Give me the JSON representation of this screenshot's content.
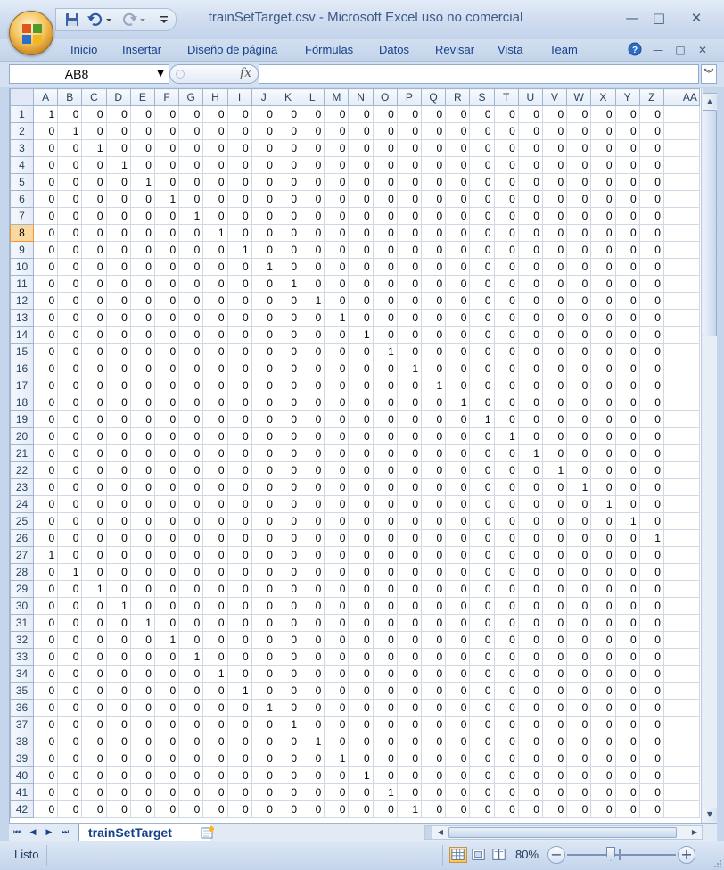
{
  "window": {
    "title": "trainSetTarget.csv - Microsoft Excel uso no comercial",
    "minimize": "—",
    "maximize": "□",
    "close": "✕"
  },
  "ribbon": {
    "tabs": [
      "Inicio",
      "Insertar",
      "Diseño de página",
      "Fórmulas",
      "Datos",
      "Revisar",
      "Vista",
      "Team"
    ]
  },
  "formula_bar": {
    "name_box": "AB8",
    "fx_label": "fx",
    "formula": ""
  },
  "grid": {
    "columns": [
      "A",
      "B",
      "C",
      "D",
      "E",
      "F",
      "G",
      "H",
      "I",
      "J",
      "K",
      "L",
      "M",
      "N",
      "O",
      "P",
      "Q",
      "R",
      "S",
      "T",
      "U",
      "V",
      "W",
      "X",
      "Y",
      "Z",
      "AA"
    ],
    "selected_row": 8,
    "rows": [
      {
        "n": 1,
        "hot": 0
      },
      {
        "n": 2,
        "hot": 1
      },
      {
        "n": 3,
        "hot": 2
      },
      {
        "n": 4,
        "hot": 3
      },
      {
        "n": 5,
        "hot": 4
      },
      {
        "n": 6,
        "hot": 5
      },
      {
        "n": 7,
        "hot": 6
      },
      {
        "n": 8,
        "hot": 7
      },
      {
        "n": 9,
        "hot": 8
      },
      {
        "n": 10,
        "hot": 9
      },
      {
        "n": 11,
        "hot": 10
      },
      {
        "n": 12,
        "hot": 11
      },
      {
        "n": 13,
        "hot": 12
      },
      {
        "n": 14,
        "hot": 13
      },
      {
        "n": 15,
        "hot": 14
      },
      {
        "n": 16,
        "hot": 15
      },
      {
        "n": 17,
        "hot": 16
      },
      {
        "n": 18,
        "hot": 17
      },
      {
        "n": 19,
        "hot": 18
      },
      {
        "n": 20,
        "hot": 19
      },
      {
        "n": 21,
        "hot": 20
      },
      {
        "n": 22,
        "hot": 21
      },
      {
        "n": 23,
        "hot": 22
      },
      {
        "n": 24,
        "hot": 23
      },
      {
        "n": 25,
        "hot": 24
      },
      {
        "n": 26,
        "hot": 25
      },
      {
        "n": 27,
        "hot": 0
      },
      {
        "n": 28,
        "hot": 1
      },
      {
        "n": 29,
        "hot": 2
      },
      {
        "n": 30,
        "hot": 3
      },
      {
        "n": 31,
        "hot": 4
      },
      {
        "n": 32,
        "hot": 5
      },
      {
        "n": 33,
        "hot": 6
      },
      {
        "n": 34,
        "hot": 7
      },
      {
        "n": 35,
        "hot": 8
      },
      {
        "n": 36,
        "hot": 9
      },
      {
        "n": 37,
        "hot": 10
      },
      {
        "n": 38,
        "hot": 11
      },
      {
        "n": 39,
        "hot": 12
      },
      {
        "n": 40,
        "hot": 13
      },
      {
        "n": 41,
        "hot": 14
      },
      {
        "n": 42,
        "hot": 15
      }
    ],
    "hot_value": "1",
    "cold_value": "0"
  },
  "sheet_tabs": {
    "active": "trainSetTarget"
  },
  "status_bar": {
    "status": "Listo",
    "zoom": "80%",
    "zoom_out": "−",
    "zoom_in": "+"
  },
  "colors": {
    "selected_row_header": "#f9d99f",
    "ribbon_text": "#15428b",
    "frame": "#c5d6ec"
  }
}
